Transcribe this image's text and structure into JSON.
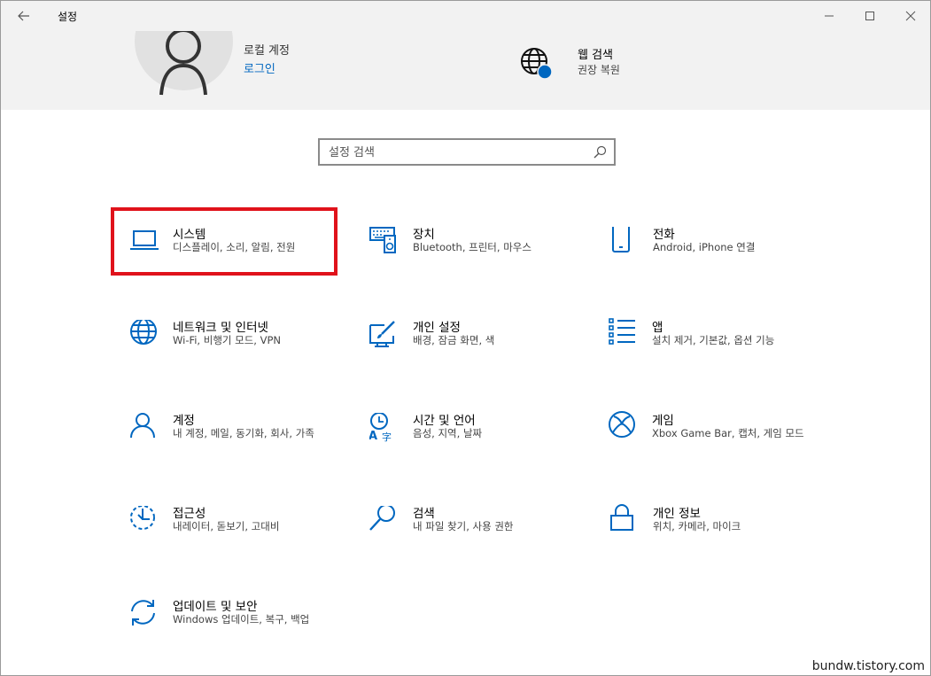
{
  "window": {
    "title": "설정"
  },
  "header": {
    "account": {
      "type": "로컬 계정",
      "login_link": "로그인"
    },
    "web_search": {
      "title": "웹 검색",
      "subtitle": "권장 복원"
    }
  },
  "search": {
    "placeholder": "설정 검색"
  },
  "tiles": [
    {
      "title": "시스템",
      "desc": "디스플레이, 소리, 알림, 전원",
      "icon": "laptop-icon"
    },
    {
      "title": "장치",
      "desc": "Bluetooth, 프린터, 마우스",
      "icon": "keyboard-speaker-icon"
    },
    {
      "title": "전화",
      "desc": "Android, iPhone 연결",
      "icon": "phone-icon"
    },
    {
      "title": "네트워크 및 인터넷",
      "desc": "Wi-Fi, 비행기 모드, VPN",
      "icon": "globe-icon"
    },
    {
      "title": "개인 설정",
      "desc": "배경, 잠금 화면, 색",
      "icon": "paint-brush-icon"
    },
    {
      "title": "앱",
      "desc": "설치 제거, 기본값, 옵션 기능",
      "icon": "app-list-icon"
    },
    {
      "title": "계정",
      "desc": "내 계정, 메일, 동기화, 회사, 가족",
      "icon": "person-icon"
    },
    {
      "title": "시간 및 언어",
      "desc": "음성, 지역, 날짜",
      "icon": "time-language-icon"
    },
    {
      "title": "게임",
      "desc": "Xbox Game Bar, 캡처, 게임 모드",
      "icon": "xbox-icon"
    },
    {
      "title": "접근성",
      "desc": "내레이터, 돋보기, 고대비",
      "icon": "ease-of-access-icon"
    },
    {
      "title": "검색",
      "desc": "내 파일 찾기, 사용 권한",
      "icon": "magnifier-icon"
    },
    {
      "title": "개인 정보",
      "desc": "위치, 카메라, 마이크",
      "icon": "lock-icon"
    },
    {
      "title": "업데이트 및 보안",
      "desc": "Windows 업데이트, 복구, 백업",
      "icon": "sync-icon"
    }
  ],
  "colors": {
    "accent": "#0067c0",
    "highlight": "#e0121b",
    "header_bg": "#f2f2f2"
  },
  "watermark": "bundw.tistory.com"
}
